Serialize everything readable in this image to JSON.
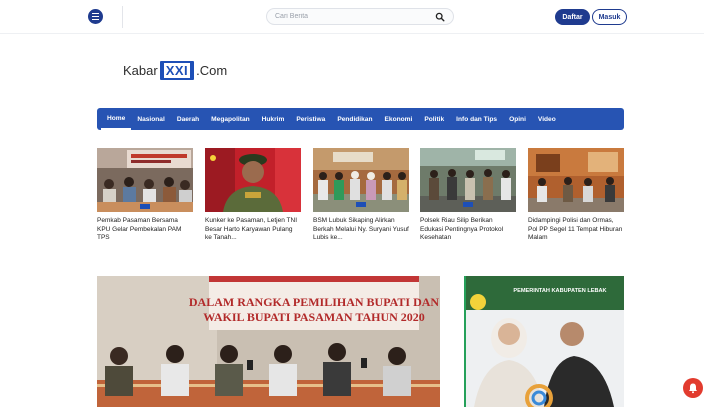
{
  "header": {
    "search_placeholder": "Cari Berita",
    "register_label": "Daftar",
    "login_label": "Masuk"
  },
  "logo": {
    "prefix": "Kabar",
    "mark": "XXI",
    "suffix": ".Com"
  },
  "nav": {
    "items": [
      "Home",
      "Nasional",
      "Daerah",
      "Megapolitan",
      "Hukrim",
      "Peristiwa",
      "Pendidikan",
      "Ekonomi",
      "Politik",
      "Info dan Tips",
      "Opini",
      "Video"
    ]
  },
  "news": [
    {
      "title": "Pemkab Pasaman Bersama KPU Gelar Pembekalan PAM TPS"
    },
    {
      "title": "Kunker ke Pasaman, Letjen TNI Besar Harto Karyawan Pulang ke Tanah..."
    },
    {
      "title": "BSM Lubuk Sikaping Alirkan Berkah Melalui Ny. Suryani Yusuf Lubis ke..."
    },
    {
      "title": "Polsek Riau Silip Berikan Edukasi Pentingnya Protokol Kesehatan"
    },
    {
      "title": "Didampingi Polisi dan Ormas, Pol PP Segel 11 Tempat Hiburan Malam"
    }
  ],
  "feature": {
    "banner_line1": "DALAM RANGKA PEMILIHAN BUPATI DAN",
    "banner_line2": "WAKIL BUPATI PASAMAN TAHUN 2020"
  },
  "ad": {
    "heading": "PEMERINTAH KABUPATEN LEBAK"
  },
  "colors": {
    "brand": "#1f3b8f",
    "nav": "#2754b3",
    "notification": "#e23b2e"
  }
}
